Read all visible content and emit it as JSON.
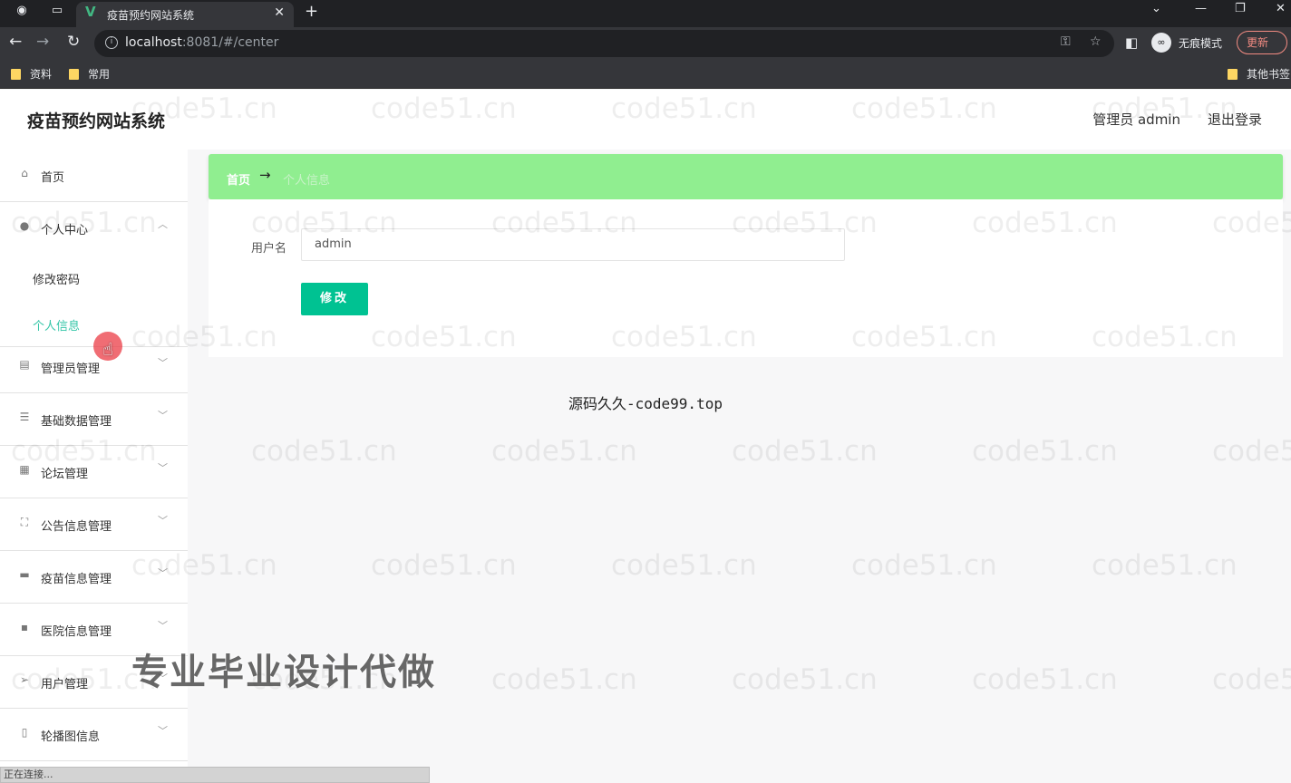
{
  "browser": {
    "tab_title": "疫苗预约网站系统",
    "tab_logo": "V",
    "url_host": "localhost",
    "url_rest": ":8081/#/center",
    "incognito_label": "无痕模式",
    "update_label": "更新",
    "bookmarks": [
      "资料",
      "常用"
    ],
    "other_bookmarks": "其他书签",
    "status_text": "正在连接..."
  },
  "header": {
    "system_title": "疫苗预约网站系统",
    "user_info": "管理员 admin",
    "logout": "退出登录"
  },
  "sidebar": {
    "items": [
      {
        "label": "首页",
        "icon": "home-icon"
      },
      {
        "label": "个人中心",
        "icon": "user-icon",
        "expanded": true,
        "children": [
          {
            "label": "修改密码"
          },
          {
            "label": "个人信息",
            "active": true
          }
        ]
      },
      {
        "label": "管理员管理",
        "icon": "clipboard-icon"
      },
      {
        "label": "基础数据管理",
        "icon": "sliders-icon"
      },
      {
        "label": "论坛管理",
        "icon": "grid-icon"
      },
      {
        "label": "公告信息管理",
        "icon": "frame-icon"
      },
      {
        "label": "疫苗信息管理",
        "icon": "monitor-icon"
      },
      {
        "label": "医院信息管理",
        "icon": "chat-icon"
      },
      {
        "label": "用户管理",
        "icon": "send-icon"
      },
      {
        "label": "轮播图信息",
        "icon": "phone-icon"
      }
    ]
  },
  "breadcrumb": {
    "home": "首页",
    "separator": "→",
    "current": "个人信息"
  },
  "form": {
    "username_label": "用户名",
    "username_value": "admin",
    "submit_label": "修改"
  },
  "footer_text": "源码久久-code99.top",
  "overlay": {
    "watermark": "code51.cn",
    "promo": "专业毕业设计代做"
  },
  "colors": {
    "breadcrumb_bg": "#90ee90",
    "primary_button": "#00c292",
    "active_menu": "#36c6a8"
  }
}
